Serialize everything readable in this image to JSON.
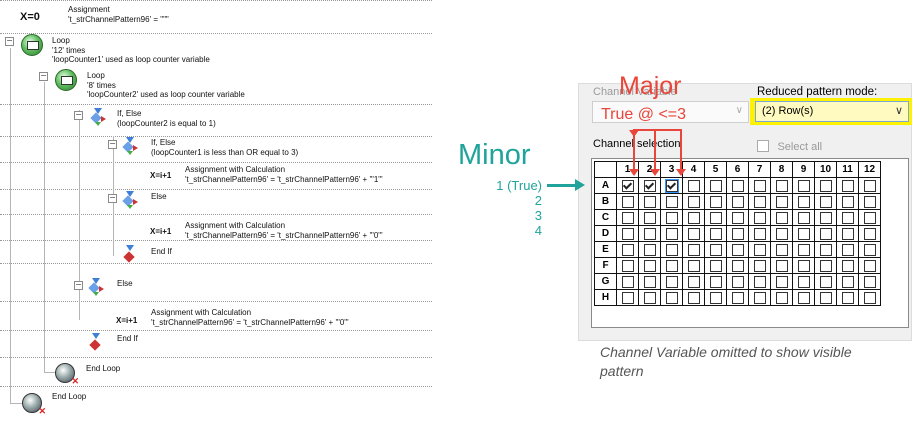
{
  "tree": {
    "assignment": {
      "symbol": "X=0",
      "title": "Assignment",
      "detail": "'t_strChannelPattern96' = \"\"\""
    },
    "loop1": {
      "title": "Loop",
      "line1": "'12' times",
      "line2": "'loopCounter1' used as loop counter variable"
    },
    "loop2": {
      "title": "Loop",
      "line1": "'8' times",
      "line2": "'loopCounter2' used as loop counter variable"
    },
    "if1": {
      "title": "If, Else",
      "detail": "(loopCounter2 is equal to 1)"
    },
    "if2": {
      "title": "If, Else",
      "detail": "(loopCounter1 is less than OR equal to 3)"
    },
    "calc1": {
      "symbol": "X=i+1",
      "title": "Assignment with Calculation",
      "detail": "'t_strChannelPattern96' = 't_strChannelPattern96' + '\"1\"'"
    },
    "else1": {
      "title": "Else"
    },
    "calc2": {
      "symbol": "X=i+1",
      "title": "Assignment with Calculation",
      "detail": "'t_strChannelPattern96' = 't_strChannelPattern96' + '\"0\"'"
    },
    "endif1": {
      "title": "End If"
    },
    "else2": {
      "title": "Else"
    },
    "calc3": {
      "symbol": "X=i+1",
      "title": "Assignment with Calculation",
      "detail": "'t_strChannelPattern96' = 't_strChannelPattern96' + '\"0\"'"
    },
    "endif2": {
      "title": "End If"
    },
    "endloop1": {
      "title": "End Loop"
    },
    "endloop2": {
      "title": "End Loop"
    },
    "expander_symbol": "−"
  },
  "panel": {
    "channel_variable_label": "Channel Variable",
    "reduced_mode_label": "Reduced pattern mode:",
    "reduced_mode_value": "(2) Row(s)",
    "channel_selection_label": "Channel selection",
    "select_all_label": "Select all",
    "columns": [
      "1",
      "2",
      "3",
      "4",
      "5",
      "6",
      "7",
      "8",
      "9",
      "10",
      "11",
      "12"
    ],
    "rows": [
      "A",
      "B",
      "C",
      "D",
      "E",
      "F",
      "G",
      "H"
    ],
    "checked_row": "A",
    "checked_columns": [
      "1",
      "2",
      "3"
    ]
  },
  "annotations": {
    "major": "Major",
    "true_cond": "True @ <=3",
    "minor": "Minor",
    "minor_values": [
      "1 (True)",
      "2",
      "3",
      "4"
    ]
  },
  "caption": "Channel Variable omitted to show visible pattern",
  "colors": {
    "red": "#e8463a",
    "teal": "#1fa39a",
    "highlight": "#fff200"
  }
}
